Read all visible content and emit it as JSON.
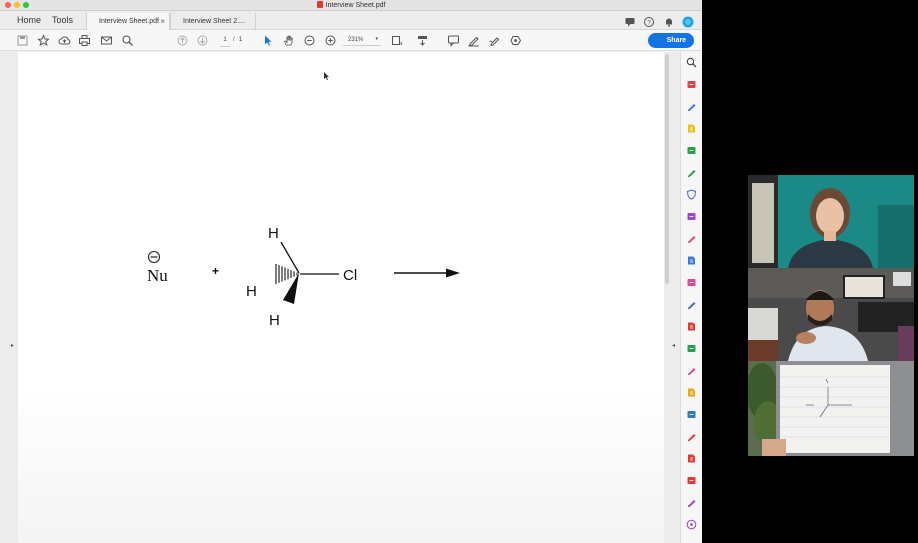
{
  "window": {
    "title": "Interview Sheet.pdf"
  },
  "menu": {
    "home": "Home",
    "tools": "Tools"
  },
  "tabs": [
    {
      "label": "Interview Sheet.pdf",
      "close": "×"
    },
    {
      "label": "Interview Sheet 2...."
    }
  ],
  "toolbar": {
    "page_current": "1",
    "page_sep": "/",
    "page_total": "1",
    "zoom": "231%",
    "share_label": "Share"
  },
  "document": {
    "charge": "⊖",
    "nucleophile": "Nu",
    "plus": "+",
    "atom_h_top": "H",
    "atom_h_left": "H",
    "atom_h_bottom": "H",
    "atom_cl": "Cl"
  },
  "colors": {
    "accent": "#1473e6",
    "pdf_red": "#e03c31",
    "sidebar_icons": [
      "#333333",
      "#d9474c",
      "#3a7bd5",
      "#e8c31c",
      "#2e9c4b",
      "#2e9c4b",
      "#4b63d6",
      "#a241c9",
      "#d94792",
      "#3a7bd5",
      "#d94792",
      "#4b63d6",
      "#e03c31",
      "#2e9c4b",
      "#d94792",
      "#e8a817",
      "#2c7dbf",
      "#e03c31",
      "#e03c31",
      "#e03c31",
      "#a241c9",
      "#a241c9"
    ]
  }
}
